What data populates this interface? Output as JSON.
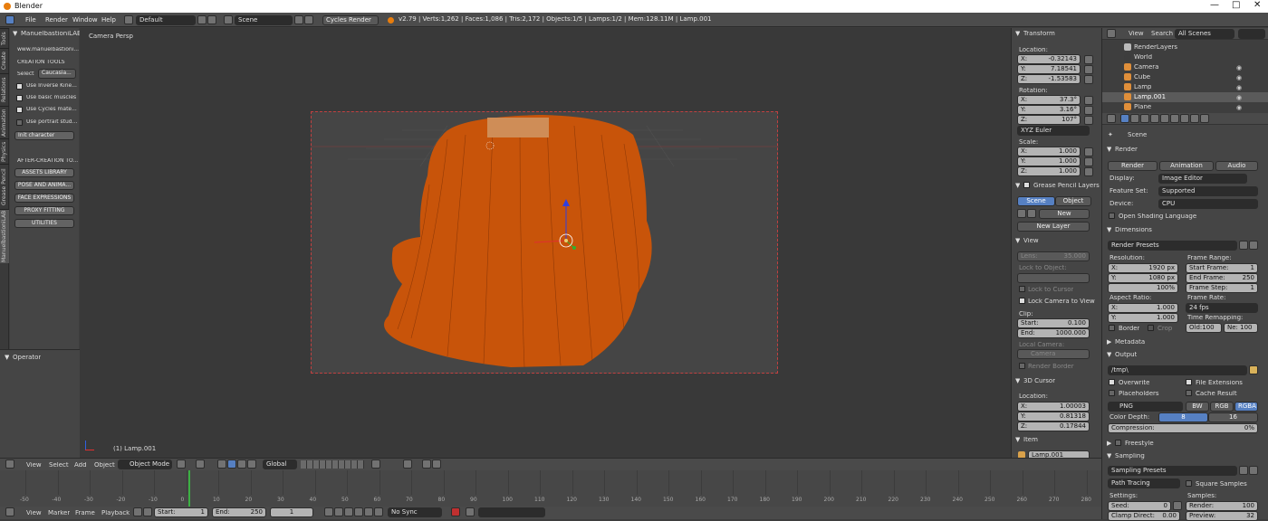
{
  "window": {
    "title": "Blender"
  },
  "menubar": {
    "menus": [
      "File",
      "Render",
      "Window",
      "Help"
    ],
    "layout": "Default",
    "scene": "Scene",
    "engine": "Cycles Render",
    "stats": "v2.79 | Verts:1,262 | Faces:1,086 | Tris:2,172 | Objects:1/5 | Lamps:1/2 | Mem:128.11M | Lamp.001"
  },
  "side_tabs": [
    "Tools",
    "Create",
    "Relations",
    "Animation",
    "Physics",
    "Grease Pencil",
    "ManuelbastioniLAB"
  ],
  "tool_panel": {
    "header": "ManuelbastioniLAB",
    "subtitle": "www.manuelbastioni...",
    "creation_tools": "CREATION TOOLS",
    "select_label": "Select",
    "select_value": "Caucasia...",
    "options": [
      "Use Inverse Kine...",
      "Use basic muscles",
      "Use Cycles mate...",
      "Use portrait stud..."
    ],
    "init_button": "Init character",
    "after_creation": "AFTER-CREATION TO...",
    "buttons": [
      "ASSETS LIBRARY",
      "POSE AND ANIMA...",
      "FACE EXPRESSIONS",
      "PROXY FITTING",
      "UTILITIES"
    ]
  },
  "operator_panel": {
    "title": "Operator"
  },
  "viewport": {
    "label": "Camera Persp",
    "active_object": "(1) Lamp.001"
  },
  "viewport_header": {
    "items": [
      "View",
      "Select",
      "Add",
      "Object"
    ],
    "mode": "Object Mode",
    "orientation": "Global"
  },
  "n_panel": {
    "transform": "Transform",
    "location_label": "Location:",
    "location": [
      {
        "axis": "X:",
        "value": "-0.32143"
      },
      {
        "axis": "Y:",
        "value": "7.18541"
      },
      {
        "axis": "Z:",
        "value": "-1.53583"
      }
    ],
    "rotation_label": "Rotation:",
    "rotation": [
      {
        "axis": "X:",
        "value": "37.3°"
      },
      {
        "axis": "Y:",
        "value": "3.16°"
      },
      {
        "axis": "Z:",
        "value": "107°"
      }
    ],
    "rotation_mode": "XYZ Euler",
    "scale_label": "Scale:",
    "scale": [
      {
        "axis": "X:",
        "value": "1.000"
      },
      {
        "axis": "Y:",
        "value": "1.000"
      },
      {
        "axis": "Z:",
        "value": "1.000"
      }
    ],
    "grease_pencil": "Grease Pencil Layers",
    "gp_scene": "Scene",
    "gp_object": "Object",
    "gp_new": "New",
    "gp_new_layer": "New Layer",
    "view": "View",
    "lens": "Lens:",
    "lens_value": "35.000",
    "lock_to_object": "Lock to Object:",
    "lock_to_cursor": "Lock to Cursor",
    "lock_camera": "Lock Camera to View",
    "clip": "Clip:",
    "clip_start_label": "Start:",
    "clip_start": "0.100",
    "clip_end_label": "End:",
    "clip_end": "1000.000",
    "local_camera": "Local Camera:",
    "camera": "Camera",
    "render_border": "Render Border",
    "cursor_3d": "3D Cursor",
    "cursor_location": [
      {
        "axis": "X:",
        "value": "1.00003"
      },
      {
        "axis": "Y:",
        "value": "0.81318"
      },
      {
        "axis": "Z:",
        "value": "0.17844"
      }
    ],
    "item": "Item",
    "item_name": "Lamp.001"
  },
  "outliner": {
    "header": {
      "view": "View",
      "search": "Search",
      "filter": "All Scenes"
    },
    "items": [
      "RenderLayers",
      "World",
      "Camera",
      "Cube",
      "Lamp",
      "Lamp.001",
      "Plane"
    ]
  },
  "properties": {
    "scene": "Scene",
    "render": "Render",
    "tabs": [
      "Render",
      "Animation",
      "Audio"
    ],
    "display_label": "Display:",
    "display_value": "Image Editor",
    "feature_label": "Feature Set:",
    "feature_value": "Supported",
    "device_label": "Device:",
    "device_value": "CPU",
    "osl": "Open Shading Language",
    "dimensions": "Dimensions",
    "render_presets": "Render Presets",
    "resolution": "Resolution:",
    "res_x": "1920 px",
    "res_y": "1080 px",
    "res_pct": "100%",
    "frame_range": "Frame Range:",
    "start_frame": "1",
    "end_frame": "250",
    "frame_step": "1",
    "aspect": "Aspect Ratio:",
    "aspect_x": "1.000",
    "aspect_y": "1.000",
    "frame_rate": "Frame Rate:",
    "fps": "24 fps",
    "time_remap": "Time Remapping:",
    "old": "Old:100",
    "new": "Ne: 100",
    "border": "Border",
    "crop": "Crop",
    "metadata": "Metadata",
    "output": "Output",
    "path": "/tmp\\",
    "overwrite": "Overwrite",
    "file_ext": "File Extensions",
    "placeholders": "Placeholders",
    "cache": "Cache Result",
    "format": "PNG",
    "bw": "BW",
    "rgb": "RGB",
    "rgba": "RGBA",
    "color_depth": "Color Depth:",
    "depth8": "8",
    "depth16": "16",
    "compression": "Compression:",
    "compression_value": "0%",
    "freestyle": "Freestyle",
    "sampling": "Sampling",
    "sampling_presets": "Sampling Presets",
    "integrator": "Path Tracing",
    "square_samples": "Square Samples",
    "settings": "Settings:",
    "seed_label": "Seed:",
    "seed": "0",
    "clamp_label": "Clamp Direct:",
    "clamp": "0.00",
    "samples": "Samples:",
    "render_samples_label": "Render:",
    "render_samples": "100",
    "preview_label": "Preview:",
    "preview_samples": "32"
  },
  "timeline": {
    "ticks": [
      "-50",
      "-40",
      "-30",
      "-20",
      "-10",
      "0",
      "10",
      "20",
      "30",
      "40",
      "50",
      "60",
      "70",
      "80",
      "90",
      "100",
      "110",
      "120",
      "130",
      "140",
      "150",
      "160",
      "170",
      "180",
      "190",
      "200",
      "210",
      "220",
      "230",
      "240",
      "250",
      "260",
      "270",
      "280"
    ],
    "header": [
      "View",
      "Marker",
      "Frame",
      "Playback"
    ],
    "start_label": "Start:",
    "start": "1",
    "end_label": "End:",
    "end": "250",
    "current": "1",
    "sync": "No Sync"
  },
  "colors": {
    "accent": "#5680c2",
    "hair": "#c8540a",
    "camera_border": "#c24040"
  }
}
